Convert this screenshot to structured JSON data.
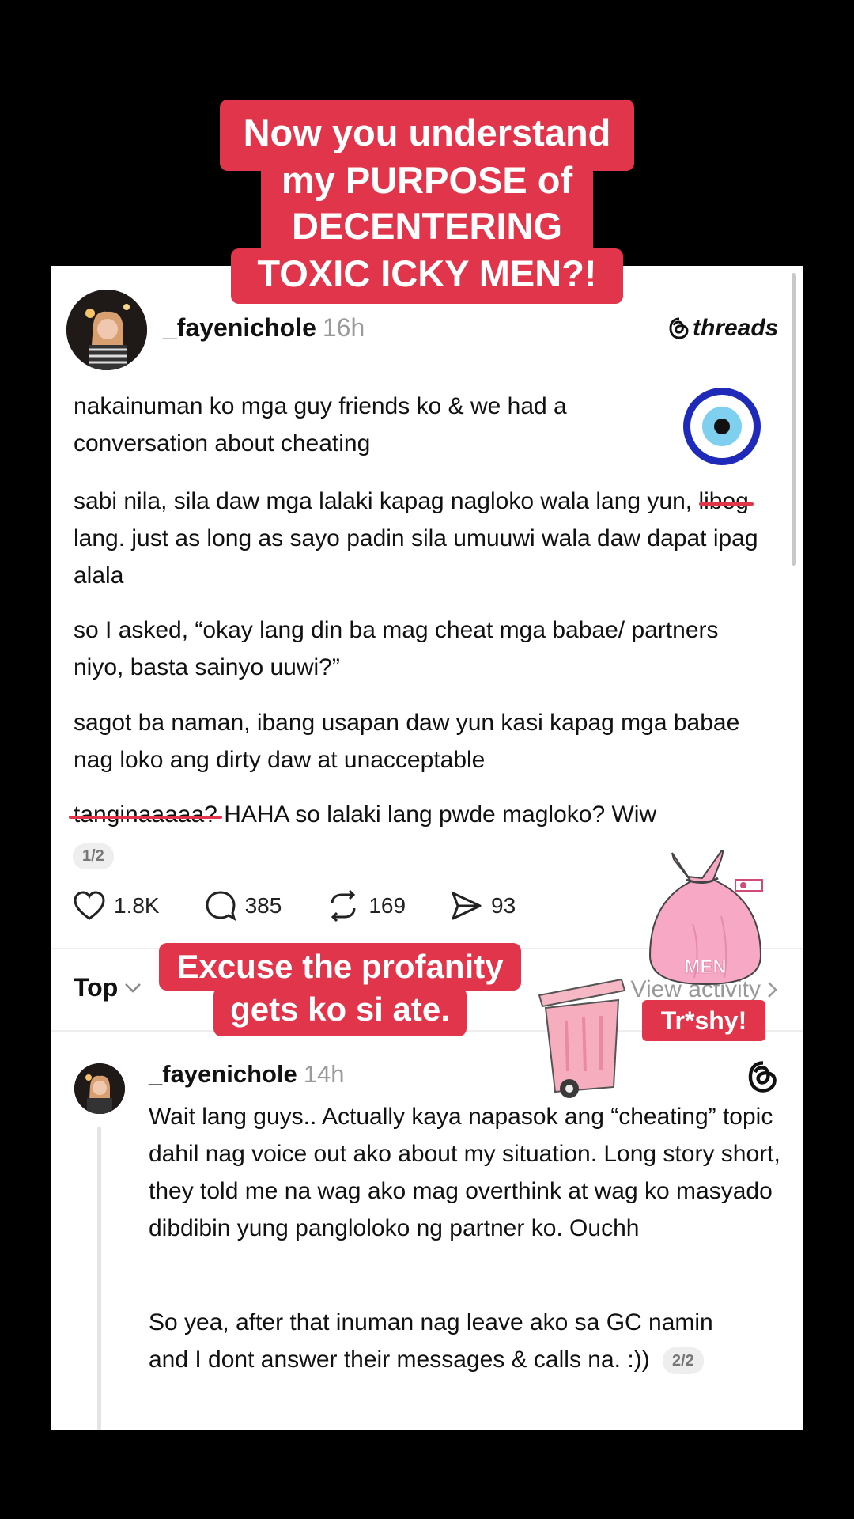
{
  "top_caption": [
    "Now you understand",
    "my PURPOSE of",
    "DECENTERING",
    "TOXIC ICKY MEN?!"
  ],
  "post": {
    "username": "_fayenichole",
    "time": "16h",
    "brand": "threads",
    "p1": "nakainuman ko mga guy friends ko & we had a conversation about cheating",
    "p2_before": "sabi nila, sila daw mga lalaki kapag nagloko wala lang yun, l",
    "p2_struck": "ibog",
    "p2_after": " lang. just as long as sayo padin sila umuuwi wala daw dapat ipag alala",
    "p3": "so I asked, “okay lang din ba mag cheat mga babae/ partners niyo, basta sainyo uuwi?”",
    "p4": "sagot ba naman, ibang usapan daw yun kasi kapag mga babae nag loko ang dirty daw at unacceptable",
    "p5_struck": "tanginaaaaa?",
    "p5_rest": " HAHA so lalaki lang pwde magloko? Wiw",
    "page_indicator": "1/2",
    "likes": "1.8K",
    "replies": "385",
    "reposts": "169",
    "shares": "93"
  },
  "sort": {
    "label": "Top",
    "view_activity": "View activity"
  },
  "mid_caption": [
    "Excuse the profanity",
    "gets ko si ate."
  ],
  "trashy_caption": "Tr*shy!",
  "bag_label": "MEN",
  "reply": {
    "username": "_fayenichole",
    "time": "14h",
    "p1": "Wait lang guys.. Actually kaya napasok ang “cheating” topic dahil nag voice out ako about my situation. Long story short, they told me na wag ako mag overthink at wag ko masyado dibdibin yung panglolo​ko ng partner ko. Ouchh",
    "p2": "So yea, after that inuman nag leave ako sa GC namin and I dont answer their messages & calls na. :))",
    "page_indicator": "2/2"
  }
}
